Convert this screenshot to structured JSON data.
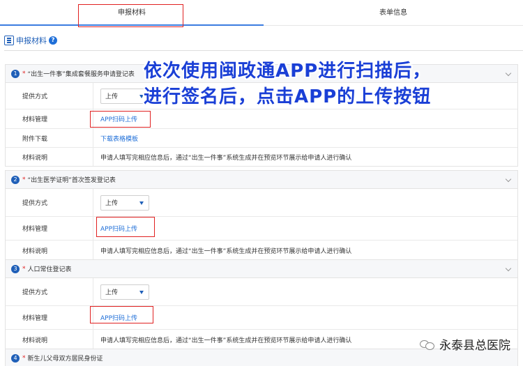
{
  "tabs": [
    {
      "label": "申报材料",
      "active": true
    },
    {
      "label": "表单信息",
      "active": false
    }
  ],
  "section": {
    "title": "申报材料",
    "help": "?"
  },
  "overlay": {
    "line1": "依次使用闽政通APP进行扫描后，",
    "line2": "进行签名后，点击APP的上传按钮"
  },
  "cards": [
    {
      "num": "1",
      "required": "*",
      "title": "“出生一件事”集成套餐服务申请登记表",
      "rows": {
        "method_label": "提供方式",
        "method_value": "上传",
        "manage_label": "材料管理",
        "manage_value": "APP扫码上传",
        "attach_label": "附件下载",
        "attach_value": "下载表格模板",
        "desc_label": "材料说明",
        "desc_value": "申请人填写完相应信息后，通过“出生一件事”系统生成并在预览环节展示给申请人进行确认"
      }
    },
    {
      "num": "2",
      "required": "*",
      "title": "“出生医学证明”首次签发登记表",
      "rows": {
        "method_label": "提供方式",
        "method_value": "上传",
        "manage_label": "材料管理",
        "manage_value": "APP扫码上传",
        "desc_label": "材料说明",
        "desc_value": "申请人填写完相应信息后，通过“出生一件事”系统生成并在预览环节展示给申请人进行确认"
      }
    },
    {
      "num": "3",
      "required": "*",
      "title": "人口常住登记表",
      "rows": {
        "method_label": "提供方式",
        "method_value": "上传",
        "manage_label": "材料管理",
        "manage_value": "APP扫码上传",
        "desc_label": "材料说明",
        "desc_value": "申请人填写完相应信息后，通过“出生一件事”系统生成并在预览环节展示给申请人进行确认"
      }
    },
    {
      "num": "4",
      "required": "*",
      "title": "新生儿父母双方居民身份证"
    }
  ],
  "watermark": {
    "text": "永泰县总医院",
    "icon": "wechat-channel-icon"
  },
  "colors": {
    "accent": "#1f5fb8",
    "link": "#1f6fd8",
    "highlight": "#e02020",
    "overlay": "#1a3fd6"
  }
}
